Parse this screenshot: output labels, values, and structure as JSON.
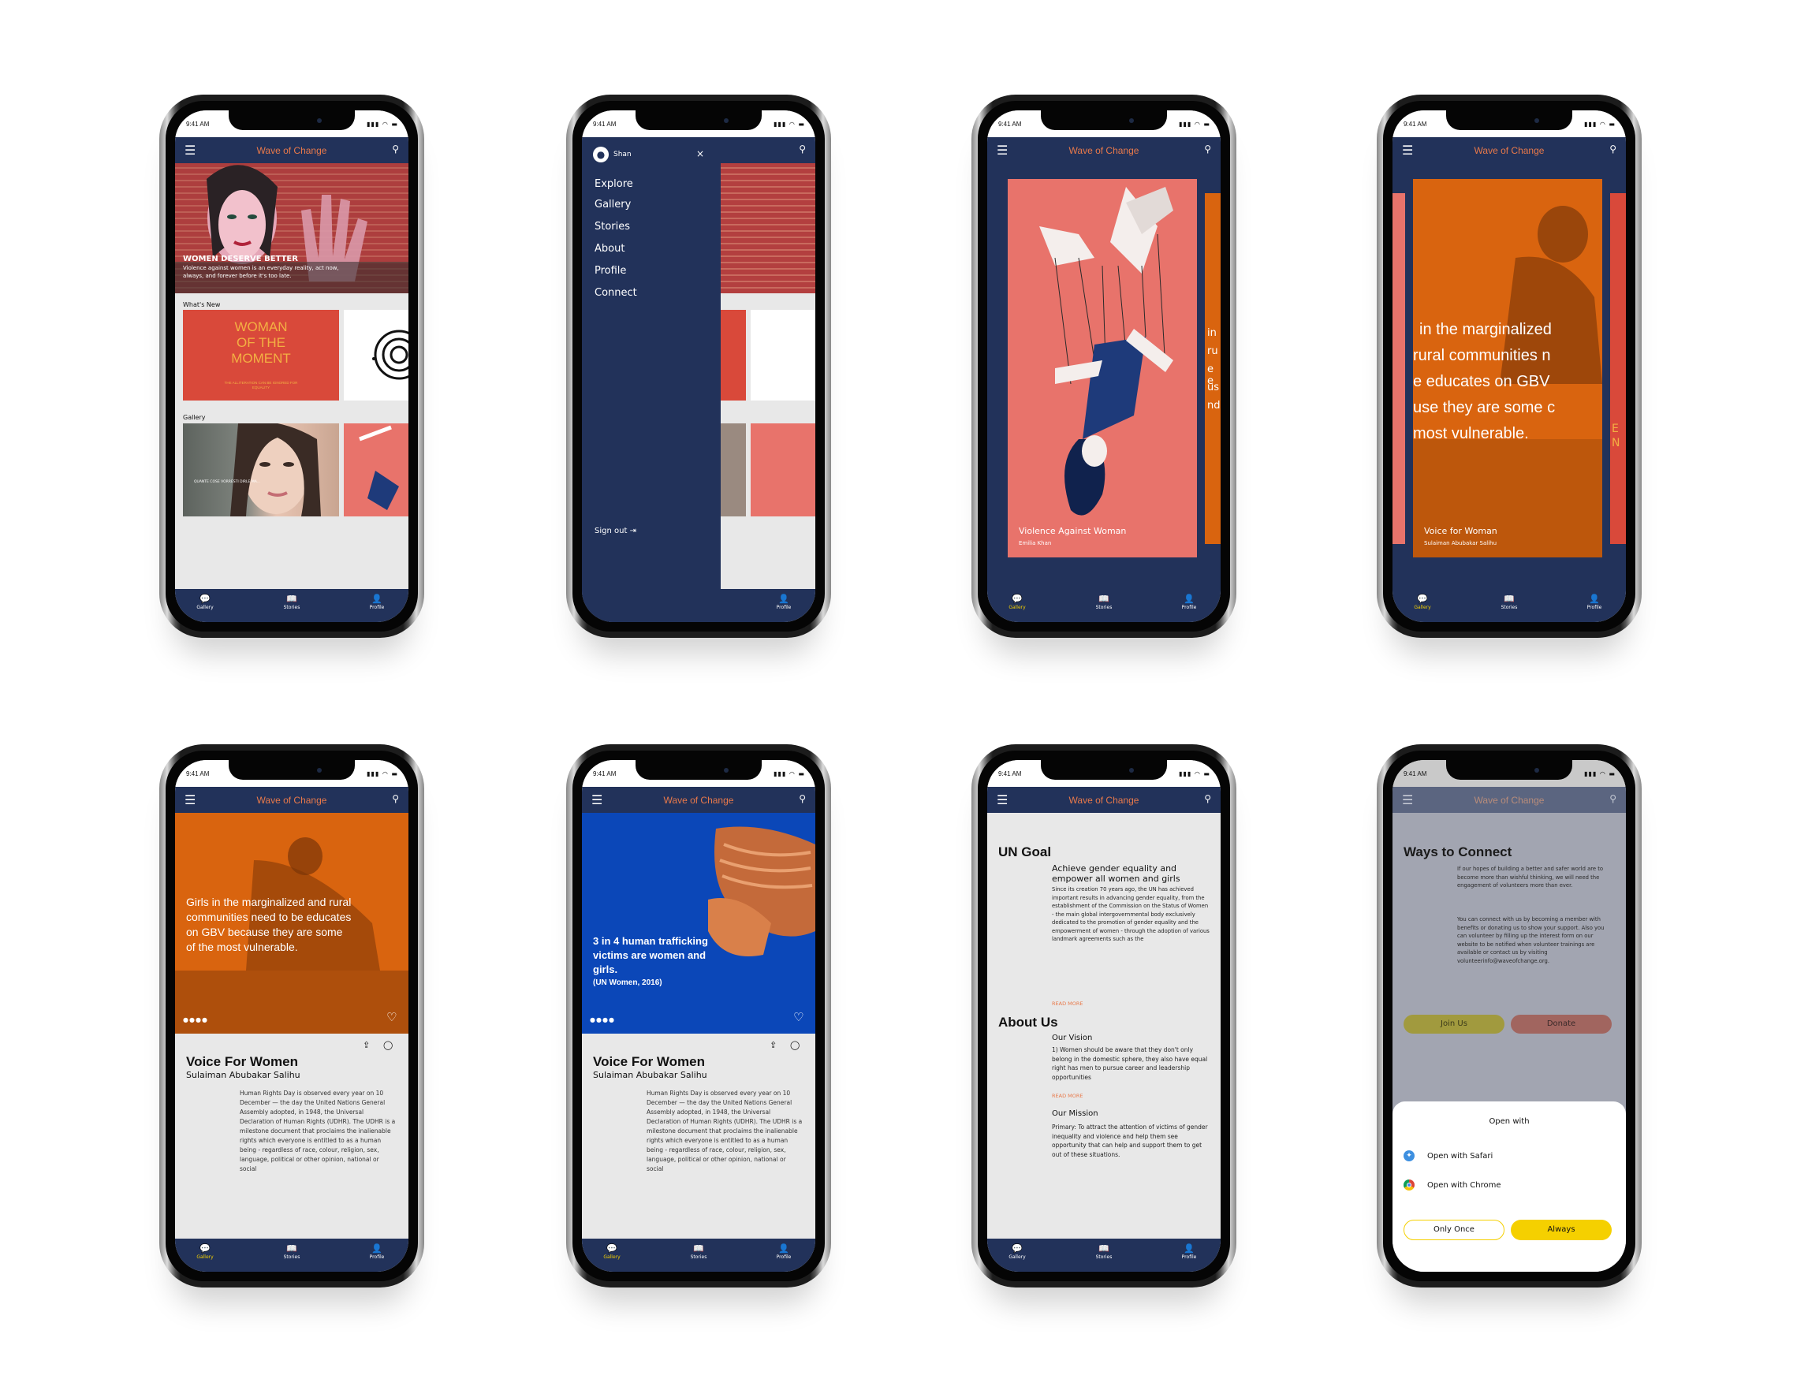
{
  "status": {
    "time": "9:41 AM",
    "icons": "▮▮▮ ◠ ▬"
  },
  "app": {
    "title": "Wave of Change",
    "menu_icon": "hamburger-icon",
    "search_icon": "search-icon"
  },
  "tabs": [
    {
      "label": "Gallery",
      "icon": "chat-bubbles-icon"
    },
    {
      "label": "Stories",
      "icon": "book-icon"
    },
    {
      "label": "Profile",
      "icon": "person-icon"
    }
  ],
  "screen1": {
    "hero_title": "WOMEN DESERVE BETTER",
    "hero_text": "Violence against women is an everyday reality, act now, always, and forever before it's too late.",
    "whats_new": "What's New",
    "card_title_1": "WOMAN",
    "card_title_2": "OF THE",
    "card_title_3": "MOMENT",
    "card_caption": "THE ALLITERATION CAN BE IGNORED FOR EQUALITY",
    "gallery": "Gallery",
    "gallery_caption": "QUANTE COSE VORRESTI DIRLE MA..."
  },
  "screen2": {
    "user": "Shan",
    "close": "×",
    "menu": [
      "Explore",
      "Gallery",
      "Stories",
      "About",
      "Profile",
      "Connect"
    ],
    "signout": "Sign out",
    "signout_icon": "logout-icon"
  },
  "screen3": {
    "title": "Violence Against Woman",
    "author": "Emilia Khan",
    "peek": [
      "in",
      "ru",
      "e e",
      "us",
      "nd"
    ]
  },
  "screen4": {
    "lines": [
      "in the marginalized",
      "rural communities n",
      "e educates on GBV",
      "use they are some c",
      "most vulnerable."
    ],
    "title": "Voice for Woman",
    "author": "Sulaiman Abubakar Salihu",
    "peek_right": "E N"
  },
  "screen5": {
    "hero_text": "Girls in the marginalized and rural communities need to be educates on GBV because they are some of the most vulnerable."
  },
  "screen6": {
    "hero_text": "3 in 4 human trafficking victims are women and girls.",
    "source": "(UN Women, 2016)"
  },
  "story": {
    "title": "Voice For Women",
    "author": "Sulaiman Abubakar Salihu",
    "body": "Human Rights Day is observed every year on 10 December — the day the United Nations General Assembly adopted, in 1948, the Universal Declaration of Human Rights (UDHR). The UDHR is a milestone document that proclaims the inalienable rights which everyone is entitled to as a human being - regardless of race, colour, religion, sex, language, political or other opinion, national or social"
  },
  "screen7": {
    "un_goal": "UN Goal",
    "un_sub": "Achieve gender equality and empower all women and girls",
    "un_body": "Since its creation 70 years ago, the UN has achieved important results in advancing gender equality, from the establishment of the Commission on the Status of Women - the main global intergovernmental body exclusively dedicated to the promotion of gender equality and the empowerment of women - through the adoption of various landmark agreements such as the",
    "read_more": "READ MORE",
    "about": "About Us",
    "vision": "Our Vision",
    "vision_body": "1) Women should be aware that they don't only belong in the domestic sphere, they also have equal right has men to pursue career and leadership opportunities",
    "mission": "Our Mission",
    "mission_body": "Primary: To attract the attention of victims of gender inequality and violence and help them see opportunity that can help and support them to get out of these situations."
  },
  "screen8": {
    "title": "Ways to Connect",
    "p1": "If our hopes of building a better and safer world are to become more than wishful thinking, we will need the engagement of volunteers more than ever.",
    "p2": "You can connect with us by becoming a member with benefits or donating us to show your support. Also you can volunteer by filling up the interest form on our website to be notified when volunteer trainings are available or contact us by visiting volunteerinfo@waveofchange.org.",
    "join": "Join Us",
    "donate": "Donate",
    "sheet_title": "Open with",
    "safari": "Open with Safari",
    "chrome": "Open with Chrome",
    "once": "Only Once",
    "always": "Always"
  },
  "colors": {
    "navy": "#22325a",
    "orange": "#e8794a",
    "yellow": "#f5d000",
    "coral": "#e8736b",
    "orange_dark": "#d96a14",
    "blue": "#0b47b8"
  }
}
